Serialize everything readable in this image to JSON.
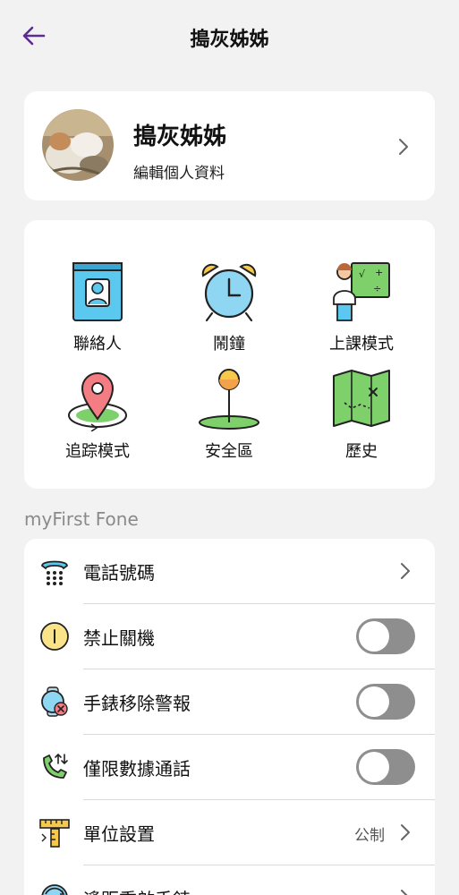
{
  "header": {
    "title": "搗灰姊姊"
  },
  "profile": {
    "name": "搗灰姊姊",
    "edit_label": "編輯個人資料"
  },
  "features": [
    {
      "label": "聯絡人",
      "icon": "contacts-book-icon"
    },
    {
      "label": "鬧鐘",
      "icon": "alarm-clock-icon"
    },
    {
      "label": "上課模式",
      "icon": "class-mode-icon"
    },
    {
      "label": "追踪模式",
      "icon": "tracking-pin-icon"
    },
    {
      "label": "安全區",
      "icon": "safe-zone-icon"
    },
    {
      "label": "歷史",
      "icon": "history-map-icon"
    }
  ],
  "section": {
    "title": "myFirst Fone"
  },
  "settings": [
    {
      "label": "電話號碼",
      "type": "link",
      "icon": "phone-icon"
    },
    {
      "label": "禁止關機",
      "type": "toggle",
      "on": false,
      "icon": "power-icon"
    },
    {
      "label": "手錶移除警報",
      "type": "toggle",
      "on": false,
      "icon": "watch-alert-icon"
    },
    {
      "label": "僅限數據通話",
      "type": "toggle",
      "on": false,
      "icon": "data-call-icon"
    },
    {
      "label": "單位設置",
      "type": "link",
      "value": "公制",
      "icon": "ruler-icon"
    },
    {
      "label": "遙距重啟手錶",
      "type": "link",
      "icon": "restart-watch-icon"
    }
  ],
  "colors": {
    "accent": "#5b2d91",
    "toggle_off": "#8e8e8e",
    "background": "#f2f2f2"
  }
}
